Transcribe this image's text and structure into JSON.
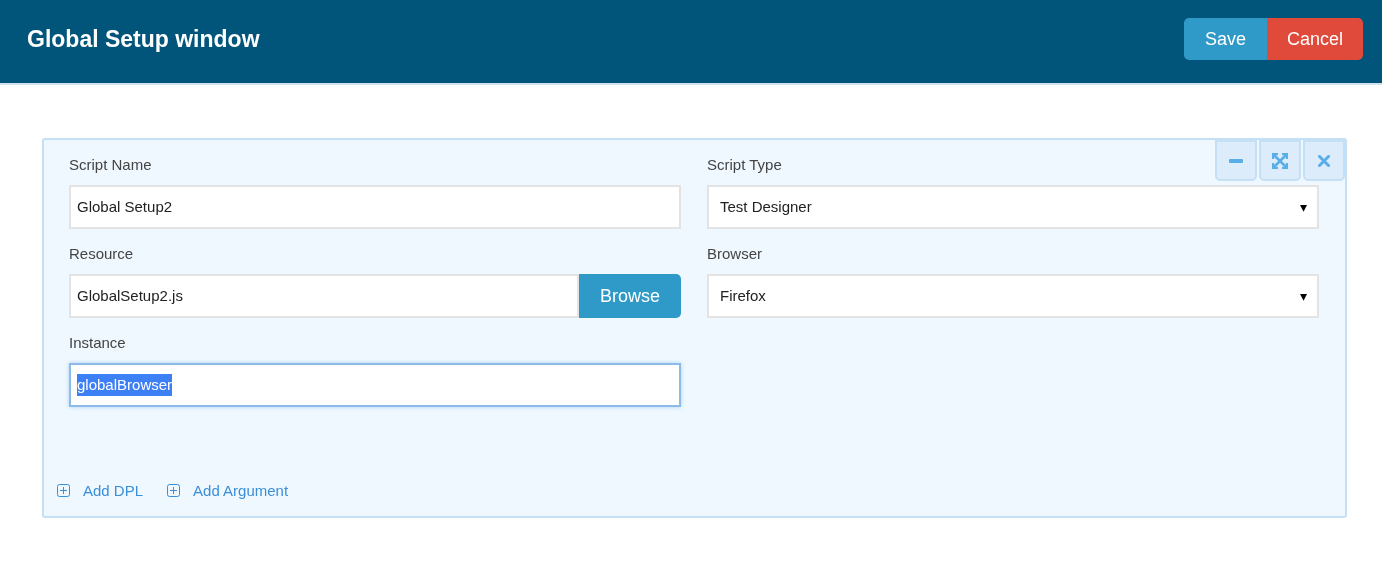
{
  "header": {
    "title": "Global Setup window",
    "buttons": [
      {
        "label": "Save",
        "kind": "primary"
      },
      {
        "label": "Cancel",
        "kind": "danger"
      }
    ]
  },
  "panel": {
    "controls": [
      {
        "kind": "minimize"
      },
      {
        "kind": "maximize"
      },
      {
        "kind": "close"
      }
    ],
    "fields": [
      {
        "label": "Script Name",
        "kind": "text",
        "value": "Global Setup2",
        "focused": false
      },
      {
        "label": "Script Type",
        "kind": "select",
        "value": "Test Designer",
        "arrow": "▾"
      },
      {
        "label": "Resource",
        "kind": "browse",
        "value": "GlobalSetup2.js",
        "button": "Browse"
      },
      {
        "label": "Browser",
        "kind": "select",
        "value": "Firefox",
        "arrow": "▾"
      },
      {
        "label": "Instance",
        "kind": "text",
        "value": "globalBrowser",
        "focused": true
      }
    ],
    "links": [
      "Add DPL",
      "Add Argument"
    ]
  }
}
